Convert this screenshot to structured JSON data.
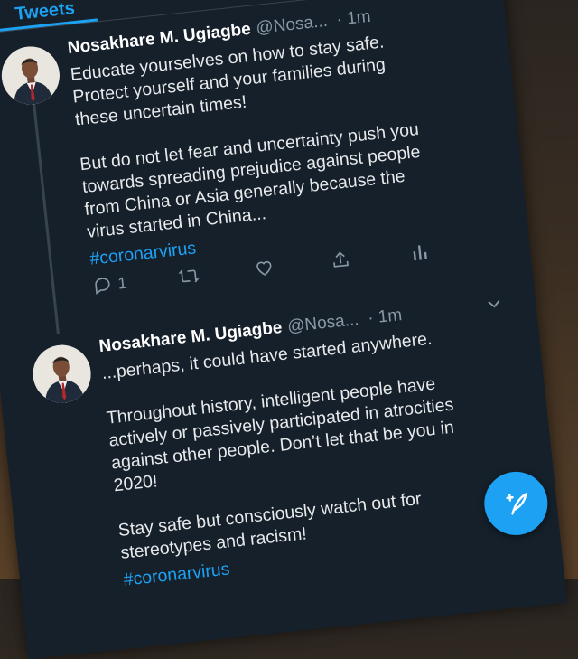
{
  "tabs": {
    "active_label": "Tweets"
  },
  "tweets": [
    {
      "display_name": "Nosakhare M. Ugiagbe",
      "handle": "@Nosa...",
      "time": "· 1m",
      "paragraphs": [
        "Educate yourselves on how to stay safe. Protect yourself and your families during these uncertain times!",
        "But do not let fear and uncertainty push you towards spreading prejudice against people from China or Asia generally because the virus started in China..."
      ],
      "hashtag": "#coronarvirus",
      "reply_count": "1"
    },
    {
      "display_name": "Nosakhare M. Ugiagbe",
      "handle": "@Nosa...",
      "time": "· 1m",
      "paragraphs": [
        "...perhaps, it could have started anywhere.",
        "Throughout history, intelligent people have actively or passively participated in atrocities against other people. Don’t let that be you in 2020!",
        "Stay safe but consciously watch out for stereotypes and racism!"
      ],
      "hashtag": "#coronarvirus"
    }
  ],
  "icons": {
    "reply": "reply-icon",
    "retweet": "retweet-icon",
    "like": "heart-icon",
    "share": "share-icon",
    "analytics": "analytics-icon",
    "more": "chevron-down-icon",
    "compose": "compose-tweet-icon"
  },
  "colors": {
    "background": "#15202b",
    "accent": "#1da1f2",
    "text": "#e7e9ea",
    "muted": "#8899a6",
    "divider": "#38444d"
  }
}
